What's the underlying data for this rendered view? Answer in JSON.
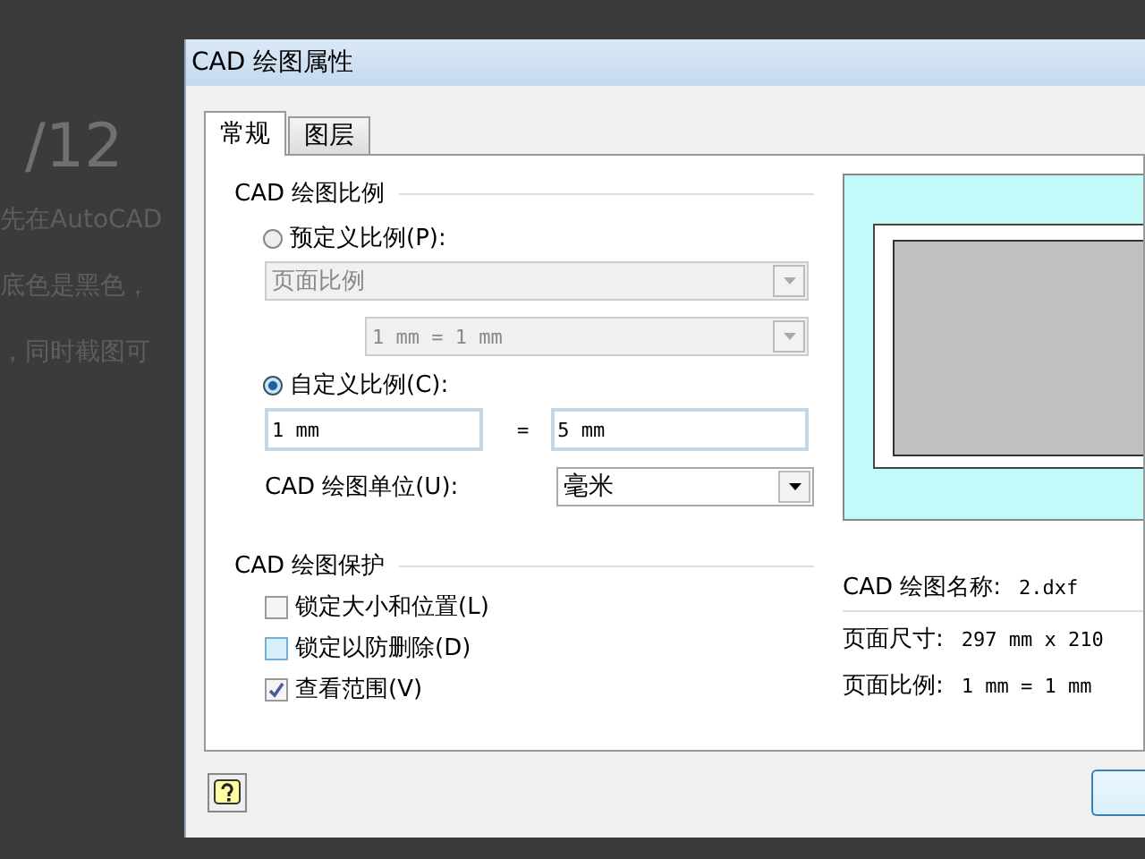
{
  "background_text": {
    "page_number": "/12",
    "lines": [
      "先在AutoCAD",
      "底色是黑色，",
      "，同时截图可"
    ]
  },
  "window": {
    "title": "CAD 绘图属性"
  },
  "tabs": [
    {
      "label": "常规",
      "selected": true
    },
    {
      "label": "图层",
      "selected": false
    }
  ],
  "scale_group": {
    "title": "CAD 绘图比例",
    "modes": [
      {
        "kind": "predefined",
        "label": "预定义比例(P):",
        "selected": false
      },
      {
        "kind": "custom",
        "label": "自定义比例(C):",
        "selected": true
      }
    ],
    "page_scale_dropdown": {
      "value": "页面比例",
      "disabled": true
    },
    "ratio_dropdown": {
      "value": "1 mm = 1 mm",
      "disabled": true
    },
    "custom_left": "1 mm",
    "equals": "=",
    "custom_right": "5 mm",
    "unit_label": "CAD 绘图单位(U):",
    "unit_dropdown": {
      "value": "毫米",
      "disabled": false
    }
  },
  "protection_group": {
    "title": "CAD 绘图保护",
    "options": [
      {
        "label": "锁定大小和位置(L)",
        "checked": false,
        "highlighted": false
      },
      {
        "label": "锁定以防删除(D)",
        "checked": false,
        "highlighted": true
      },
      {
        "label": "查看范围(V)",
        "checked": true,
        "highlighted": false
      }
    ]
  },
  "info": [
    {
      "label": "CAD 绘图名称:",
      "value": "2.dxf"
    },
    {
      "label": "页面尺寸:",
      "value": "297 mm x 210"
    },
    {
      "label": "页面比例:",
      "value": "1 mm = 1 mm"
    }
  ]
}
